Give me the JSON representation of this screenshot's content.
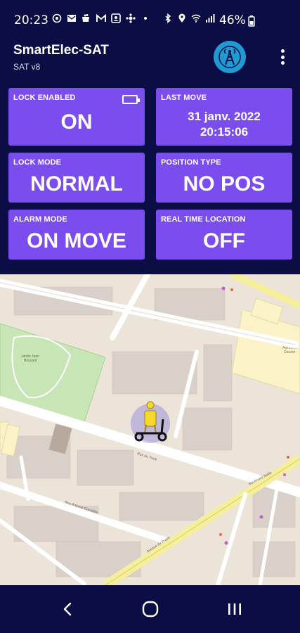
{
  "status_bar": {
    "time": "20:23",
    "battery_percent": "46%",
    "icons_left": [
      "location-pin-icon",
      "mail-icon",
      "cup-icon",
      "gmail-icon",
      "contact-card-icon",
      "app-icon",
      "dot-icon"
    ],
    "icons_right": [
      "bluetooth-icon",
      "location-icon",
      "wifi-icon",
      "signal-icon",
      "battery-icon"
    ]
  },
  "app_bar": {
    "title": "SmartElec-SAT",
    "subtitle": "SAT v8",
    "logo_icon": "antenna-tower-icon",
    "menu_icon": "more-vert-icon"
  },
  "cards": {
    "lock_enabled": {
      "label": "LOCK ENABLED",
      "value": "ON",
      "icon": "battery-outline-icon"
    },
    "last_move": {
      "label": "LAST MOVE",
      "date": "31 janv. 2022",
      "time": "20:15:06"
    },
    "lock_mode": {
      "label": "LOCK MODE",
      "value": "NORMAL"
    },
    "position_type": {
      "label": "POSITION TYPE",
      "value": "NO POS"
    },
    "alarm_mode": {
      "label": "ALARM MODE",
      "value": "ON MOVE"
    },
    "real_time_location": {
      "label": "REAL TIME LOCATION",
      "value": "OFF"
    }
  },
  "map": {
    "marker_icon": "scooter-rider-icon",
    "labels": {
      "park": "Jardin Jean\nBouvard",
      "college": "Collège\nAlphonse\nDaudet",
      "street1": "Rue du Tivoli",
      "street2": "Rue Antoine Cruvellier",
      "street3": "Avenue du Prado",
      "street4": "Boulevard Baille"
    }
  },
  "nav_bar": {
    "back_icon": "back-chevron-icon",
    "home_icon": "home-circle-icon",
    "recents_icon": "recents-icon"
  },
  "colors": {
    "background": "#0b0e45",
    "card": "#7c4dee",
    "logo": "#1f9bd3"
  }
}
